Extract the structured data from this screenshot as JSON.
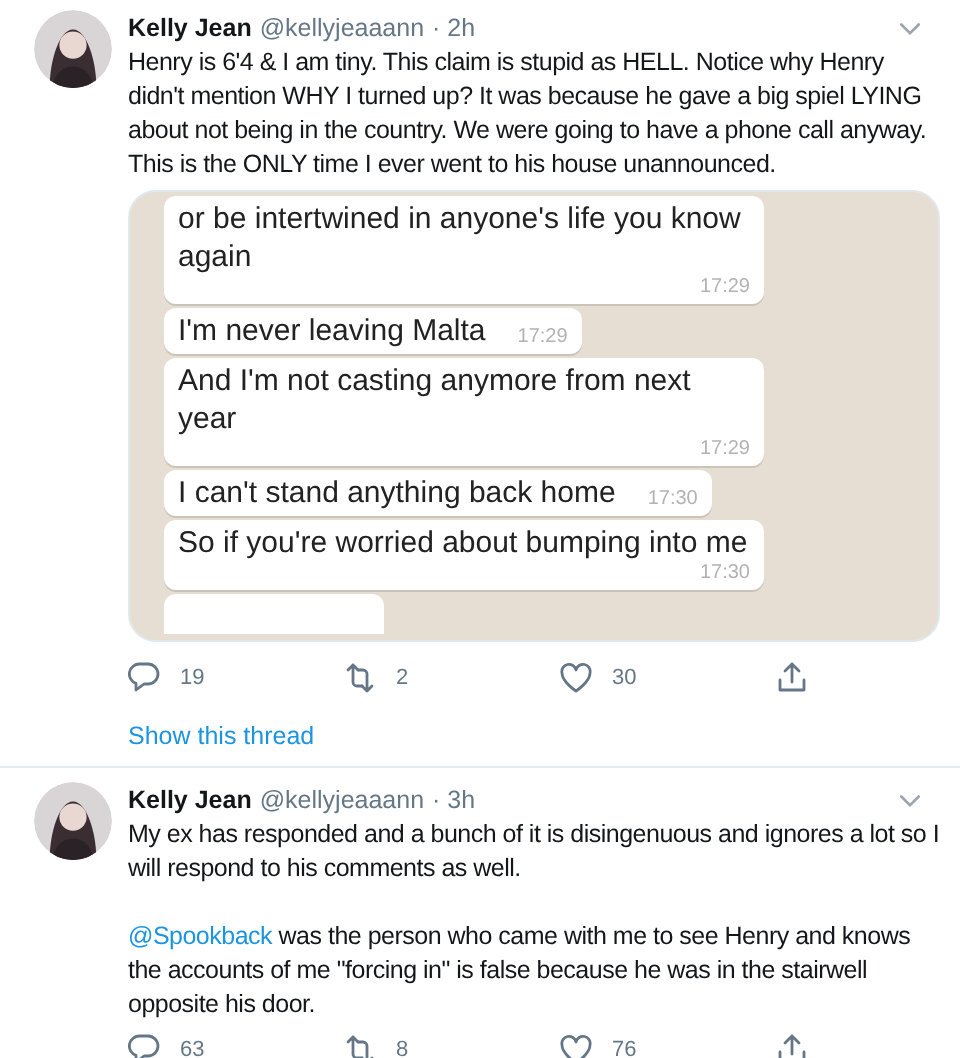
{
  "tweets": [
    {
      "author": "Kelly Jean",
      "handle": "@kellyjeaaann",
      "time": "· 2h",
      "paragraphs": [
        {
          "text": "Henry is 6'4 & I am tiny. This claim is stupid as HELL. Notice why Henry didn't mention WHY I turned up? It was because he gave a big spiel LYING about not being in the country. We were going to have a phone call anyway. This is the ONLY time I ever went to his house unannounced."
        }
      ],
      "image": {
        "kind": "chat",
        "messages": [
          {
            "text": "or be intertwined in anyone's life you know again",
            "time": "17:29"
          },
          {
            "text": "I'm never leaving Malta",
            "time": "17:29"
          },
          {
            "text": "And I'm not casting anymore from next year",
            "time": "17:29"
          },
          {
            "text": "I can't stand anything back home",
            "time": "17:30"
          },
          {
            "text": "So if you're worried about bumping into me",
            "time": "17:30"
          }
        ]
      },
      "replies": "19",
      "retweets": "2",
      "likes": "30",
      "show_thread": "Show this thread"
    },
    {
      "author": "Kelly Jean",
      "handle": "@kellyjeaaann",
      "time": "· 3h",
      "paragraphs": [
        {
          "text": "My ex has responded and a bunch of it is disingenuous and ignores a lot so I will respond to his comments as well."
        },
        {
          "mention": "@Spookback",
          "text": " was the person who came with me to see Henry and knows the accounts of me \"forcing in\" is false because he was in the stairwell opposite his door."
        }
      ],
      "replies": "63",
      "retweets": "8",
      "likes": "76"
    }
  ]
}
